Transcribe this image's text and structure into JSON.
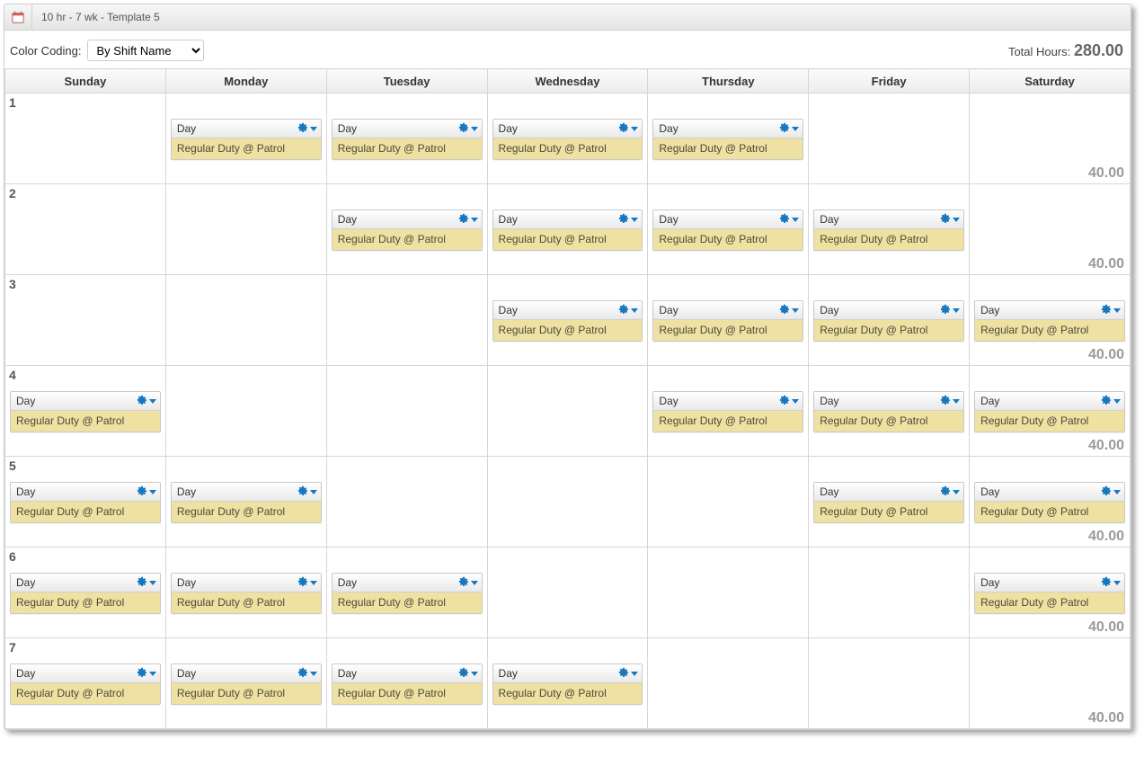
{
  "header": {
    "title": "10 hr - 7 wk - Template 5"
  },
  "toolbar": {
    "color_coding_label": "Color Coding:",
    "color_coding_value": "By Shift Name",
    "total_label": "Total Hours:",
    "total_value": "280.00"
  },
  "days": [
    "Sunday",
    "Monday",
    "Tuesday",
    "Wednesday",
    "Thursday",
    "Friday",
    "Saturday"
  ],
  "shift": {
    "name": "Day",
    "detail": "Regular Duty @ Patrol"
  },
  "weeks": [
    {
      "num": "1",
      "hours": "40.00",
      "cells": [
        false,
        true,
        true,
        true,
        true,
        false,
        false
      ]
    },
    {
      "num": "2",
      "hours": "40.00",
      "cells": [
        false,
        false,
        true,
        true,
        true,
        true,
        false
      ]
    },
    {
      "num": "3",
      "hours": "40.00",
      "cells": [
        false,
        false,
        false,
        true,
        true,
        true,
        true
      ]
    },
    {
      "num": "4",
      "hours": "40.00",
      "cells": [
        true,
        false,
        false,
        false,
        true,
        true,
        true
      ]
    },
    {
      "num": "5",
      "hours": "40.00",
      "cells": [
        true,
        true,
        false,
        false,
        false,
        true,
        true
      ]
    },
    {
      "num": "6",
      "hours": "40.00",
      "cells": [
        true,
        true,
        true,
        false,
        false,
        false,
        true
      ]
    },
    {
      "num": "7",
      "hours": "40.00",
      "cells": [
        true,
        true,
        true,
        true,
        false,
        false,
        false
      ]
    }
  ]
}
